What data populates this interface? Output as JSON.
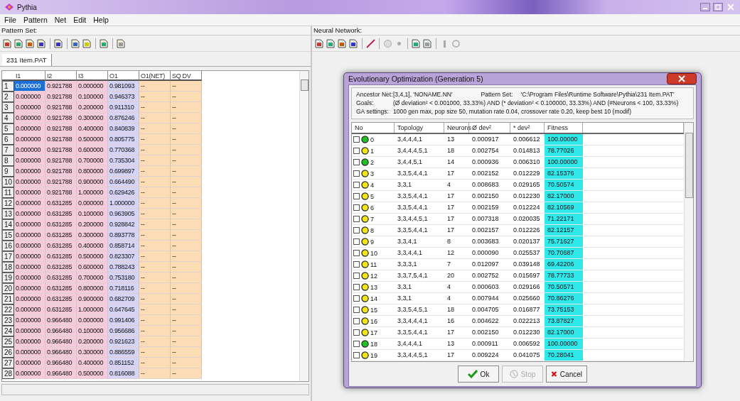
{
  "window": {
    "title": "Pythia"
  },
  "menu": [
    "File",
    "Pattern",
    "Net",
    "Edit",
    "Help"
  ],
  "pattern_set": {
    "label": "Pattern Set:",
    "tabs": [
      {
        "label": "231 Item.PAT",
        "selected": true
      }
    ],
    "columns": [
      {
        "label": "I1",
        "kind": "input"
      },
      {
        "label": "I2",
        "kind": "input"
      },
      {
        "label": "I3",
        "kind": "input"
      },
      {
        "label": "O1",
        "kind": "output"
      },
      {
        "label": "O1(NET)",
        "kind": "result"
      },
      {
        "label": "SQ DV",
        "kind": "result"
      }
    ],
    "rows": [
      {
        "no": "1",
        "selected": true,
        "cells": [
          "0.000000",
          "0.921788",
          "0.000000",
          "0.981093",
          "--",
          "--"
        ]
      },
      {
        "no": "2",
        "selected": false,
        "cells": [
          "0.000000",
          "0.921788",
          "0.100000",
          "0.946373",
          "--",
          "--"
        ]
      },
      {
        "no": "3",
        "selected": false,
        "cells": [
          "0.000000",
          "0.921788",
          "0.200000",
          "0.911310",
          "--",
          "--"
        ]
      },
      {
        "no": "4",
        "selected": false,
        "cells": [
          "0.000000",
          "0.921788",
          "0.300000",
          "0.876246",
          "--",
          "--"
        ]
      },
      {
        "no": "5",
        "selected": false,
        "cells": [
          "0.000000",
          "0.921788",
          "0.400000",
          "0.840839",
          "--",
          "--"
        ]
      },
      {
        "no": "6",
        "selected": false,
        "cells": [
          "0.000000",
          "0.921788",
          "0.500000",
          "0.805775",
          "--",
          "--"
        ]
      },
      {
        "no": "7",
        "selected": false,
        "cells": [
          "0.000000",
          "0.921788",
          "0.600000",
          "0.770368",
          "--",
          "--"
        ]
      },
      {
        "no": "8",
        "selected": false,
        "cells": [
          "0.000000",
          "0.921788",
          "0.700000",
          "0.735304",
          "--",
          "--"
        ]
      },
      {
        "no": "9",
        "selected": false,
        "cells": [
          "0.000000",
          "0.921788",
          "0.800000",
          "0.699897",
          "--",
          "--"
        ]
      },
      {
        "no": "10",
        "selected": false,
        "cells": [
          "0.000000",
          "0.921788",
          "0.900000",
          "0.664490",
          "--",
          "--"
        ]
      },
      {
        "no": "11",
        "selected": false,
        "cells": [
          "0.000000",
          "0.921788",
          "1.000000",
          "0.629426",
          "--",
          "--"
        ]
      },
      {
        "no": "12",
        "selected": false,
        "cells": [
          "0.000000",
          "0.631285",
          "0.000000",
          "1.000000",
          "--",
          "--"
        ]
      },
      {
        "no": "13",
        "selected": false,
        "cells": [
          "0.000000",
          "0.631285",
          "0.100000",
          "0.963905",
          "--",
          "--"
        ]
      },
      {
        "no": "14",
        "selected": false,
        "cells": [
          "0.000000",
          "0.631285",
          "0.200000",
          "0.928842",
          "--",
          "--"
        ]
      },
      {
        "no": "15",
        "selected": false,
        "cells": [
          "0.000000",
          "0.631285",
          "0.300000",
          "0.893778",
          "--",
          "--"
        ]
      },
      {
        "no": "16",
        "selected": false,
        "cells": [
          "0.000000",
          "0.631285",
          "0.400000",
          "0.858714",
          "--",
          "--"
        ]
      },
      {
        "no": "17",
        "selected": false,
        "cells": [
          "0.000000",
          "0.631285",
          "0.500000",
          "0.823307",
          "--",
          "--"
        ]
      },
      {
        "no": "18",
        "selected": false,
        "cells": [
          "0.000000",
          "0.631285",
          "0.600000",
          "0.788243",
          "--",
          "--"
        ]
      },
      {
        "no": "19",
        "selected": false,
        "cells": [
          "0.000000",
          "0.631285",
          "0.700000",
          "0.753180",
          "--",
          "--"
        ]
      },
      {
        "no": "20",
        "selected": false,
        "cells": [
          "0.000000",
          "0.631285",
          "0.800000",
          "0.718116",
          "--",
          "--"
        ]
      },
      {
        "no": "21",
        "selected": false,
        "cells": [
          "0.000000",
          "0.631285",
          "0.900000",
          "0.682709",
          "--",
          "--"
        ]
      },
      {
        "no": "22",
        "selected": false,
        "cells": [
          "0.000000",
          "0.631285",
          "1.000000",
          "0.647645",
          "--",
          "--"
        ]
      },
      {
        "no": "23",
        "selected": false,
        "cells": [
          "0.000000",
          "0.966480",
          "0.000000",
          "0.991406",
          "--",
          "--"
        ]
      },
      {
        "no": "24",
        "selected": false,
        "cells": [
          "0.000000",
          "0.966480",
          "0.100000",
          "0.956686",
          "--",
          "--"
        ]
      },
      {
        "no": "25",
        "selected": false,
        "cells": [
          "0.000000",
          "0.966480",
          "0.200000",
          "0.921623",
          "--",
          "--"
        ]
      },
      {
        "no": "26",
        "selected": false,
        "cells": [
          "0.000000",
          "0.966480",
          "0.300000",
          "0.886559",
          "--",
          "--"
        ]
      },
      {
        "no": "27",
        "selected": false,
        "cells": [
          "0.000000",
          "0.966480",
          "0.400000",
          "0.851152",
          "--",
          "--"
        ]
      },
      {
        "no": "28",
        "selected": false,
        "cells": [
          "0.000000",
          "0.966480",
          "0.500000",
          "0.816088",
          "--",
          "--"
        ]
      }
    ]
  },
  "neural_network": {
    "label": "Neural Network:"
  },
  "dialog": {
    "title": "Evolutionary Optimization (Generation 5)",
    "info": [
      {
        "label": "Ancestor Net:",
        "value": "[3,4,1], 'NONAME.NN'",
        "label_2": "Pattern Set:",
        "value_2": "'C:\\Program Files\\Runtime Software\\Pythia\\231 Item.PAT'"
      },
      {
        "label": "Goals:",
        "value": "(Ø deviation² <  0.001000, 33.33%)   AND   (* deviation² <  0.100000, 33.33%)   AND   (#Neurons < 100, 33.33%)"
      },
      {
        "label": "GA settings:",
        "value": "1000 gen max, pop size 50, mutation rate 0.04, crossover rate 0.20, keep best 10 (modif)"
      }
    ],
    "columns": [
      "No",
      "Topology",
      "Neurons",
      "Ø dev²",
      "* dev²",
      "Fitness"
    ],
    "rows": [
      {
        "checked": false,
        "color": "#22c022",
        "no": "0",
        "topology": "3,4,4,4,1",
        "neurons": "13",
        "avg_dev": "0.000917",
        "max_dev": "0.006612",
        "fitness": "100.00000"
      },
      {
        "checked": false,
        "color": "#f2e21a",
        "no": "1",
        "topology": "3,4,4,4,5,1",
        "neurons": "18",
        "avg_dev": "0.002754",
        "max_dev": "0.014813",
        "fitness": "78.77026"
      },
      {
        "checked": false,
        "color": "#22c022",
        "no": "2",
        "topology": "3,4,4,5,1",
        "neurons": "14",
        "avg_dev": "0.000936",
        "max_dev": "0.006310",
        "fitness": "100.00000"
      },
      {
        "checked": false,
        "color": "#f2e21a",
        "no": "3",
        "topology": "3,3,5,4,4,1",
        "neurons": "17",
        "avg_dev": "0.002152",
        "max_dev": "0.012229",
        "fitness": "82.15376"
      },
      {
        "checked": false,
        "color": "#f2e21a",
        "no": "4",
        "topology": "3,3,1",
        "neurons": "4",
        "avg_dev": "0.008683",
        "max_dev": "0.029165",
        "fitness": "70.50574"
      },
      {
        "checked": false,
        "color": "#f2e21a",
        "no": "5",
        "topology": "3,3,5,4,4,1",
        "neurons": "17",
        "avg_dev": "0.002150",
        "max_dev": "0.012230",
        "fitness": "82.17000"
      },
      {
        "checked": false,
        "color": "#f2e21a",
        "no": "6",
        "topology": "3,3,5,4,4,1",
        "neurons": "17",
        "avg_dev": "0.002159",
        "max_dev": "0.012224",
        "fitness": "82.10569"
      },
      {
        "checked": false,
        "color": "#f2e21a",
        "no": "7",
        "topology": "3,3,4,4,5,1",
        "neurons": "17",
        "avg_dev": "0.007318",
        "max_dev": "0.020035",
        "fitness": "71.22171"
      },
      {
        "checked": false,
        "color": "#f2e21a",
        "no": "8",
        "topology": "3,3,5,4,4,1",
        "neurons": "17",
        "avg_dev": "0.002157",
        "max_dev": "0.012226",
        "fitness": "82.12157"
      },
      {
        "checked": false,
        "color": "#f2e21a",
        "no": "9",
        "topology": "3,3,4,1",
        "neurons": "8",
        "avg_dev": "0.003683",
        "max_dev": "0.020137",
        "fitness": "75.71627"
      },
      {
        "checked": false,
        "color": "#f2e21a",
        "no": "10",
        "topology": "3,3,4,4,1",
        "neurons": "12",
        "avg_dev": "0.000090",
        "max_dev": "0.025537",
        "fitness": "70.70687"
      },
      {
        "checked": false,
        "color": "#f2e21a",
        "no": "11",
        "topology": "3,3,3,1",
        "neurons": "7",
        "avg_dev": "0.012097",
        "max_dev": "0.039148",
        "fitness": "69.42206"
      },
      {
        "checked": false,
        "color": "#f2e21a",
        "no": "12",
        "topology": "3,3,7,5,4,1",
        "neurons": "20",
        "avg_dev": "0.002752",
        "max_dev": "0.015697",
        "fitness": "78.77733"
      },
      {
        "checked": false,
        "color": "#f2e21a",
        "no": "13",
        "topology": "3,3,1",
        "neurons": "4",
        "avg_dev": "0.000603",
        "max_dev": "0.029166",
        "fitness": "70.50571"
      },
      {
        "checked": false,
        "color": "#f2e21a",
        "no": "14",
        "topology": "3,3,1",
        "neurons": "4",
        "avg_dev": "0.007944",
        "max_dev": "0.025660",
        "fitness": "70.86276"
      },
      {
        "checked": false,
        "color": "#f2e21a",
        "no": "15",
        "topology": "3,3,5,4,5,1",
        "neurons": "18",
        "avg_dev": "0.004705",
        "max_dev": "0.016877",
        "fitness": "73.75153"
      },
      {
        "checked": false,
        "color": "#f2e21a",
        "no": "16",
        "topology": "3,3,4,4,4,1",
        "neurons": "16",
        "avg_dev": "0.004622",
        "max_dev": "0.022213",
        "fitness": "73.87827"
      },
      {
        "checked": false,
        "color": "#f2e21a",
        "no": "17",
        "topology": "3,3,5,4,4,1",
        "neurons": "17",
        "avg_dev": "0.002150",
        "max_dev": "0.012230",
        "fitness": "82.17000"
      },
      {
        "checked": false,
        "color": "#22c022",
        "no": "18",
        "topology": "3,4,4,4,1",
        "neurons": "13",
        "avg_dev": "0.000911",
        "max_dev": "0.006592",
        "fitness": "100.00000"
      },
      {
        "checked": false,
        "color": "#f2e21a",
        "no": "19",
        "topology": "3,3,4,4,5,1",
        "neurons": "17",
        "avg_dev": "0.009224",
        "max_dev": "0.041075",
        "fitness": "70.28041"
      }
    ],
    "buttons": [
      {
        "label": "Ok",
        "kind": "ok",
        "disabled": false
      },
      {
        "label": "Stop",
        "kind": "stop",
        "disabled": true
      },
      {
        "label": "Cancel",
        "kind": "cancel",
        "disabled": false
      }
    ]
  }
}
